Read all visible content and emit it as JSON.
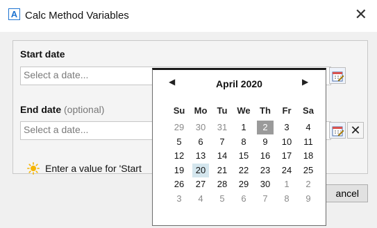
{
  "window": {
    "title": "Calc Method Variables",
    "app_icon_letter": "A",
    "close_glyph": "✕"
  },
  "form": {
    "start_label": "Start date",
    "start_placeholder": "Select a date...",
    "end_label": "End date",
    "end_optional": "(optional)",
    "end_placeholder": "Select a date...",
    "clear_glyph": "✕",
    "status_text": "Enter a value for 'Start",
    "cancel_label": "ancel"
  },
  "calendar": {
    "month_label": "April 2020",
    "prev_glyph": "◀",
    "next_glyph": "▶",
    "weekdays": [
      "Su",
      "Mo",
      "Tu",
      "We",
      "Th",
      "Fr",
      "Sa"
    ],
    "weeks": [
      [
        {
          "d": "29",
          "o": true
        },
        {
          "d": "30",
          "o": true
        },
        {
          "d": "31",
          "o": true
        },
        {
          "d": "1"
        },
        {
          "d": "2",
          "sel": true
        },
        {
          "d": "3"
        },
        {
          "d": "4"
        }
      ],
      [
        {
          "d": "5"
        },
        {
          "d": "6"
        },
        {
          "d": "7"
        },
        {
          "d": "8"
        },
        {
          "d": "9"
        },
        {
          "d": "10"
        },
        {
          "d": "11"
        }
      ],
      [
        {
          "d": "12"
        },
        {
          "d": "13"
        },
        {
          "d": "14"
        },
        {
          "d": "15"
        },
        {
          "d": "16"
        },
        {
          "d": "17"
        },
        {
          "d": "18"
        }
      ],
      [
        {
          "d": "19"
        },
        {
          "d": "20",
          "today": true
        },
        {
          "d": "21"
        },
        {
          "d": "22"
        },
        {
          "d": "23"
        },
        {
          "d": "24"
        },
        {
          "d": "25"
        }
      ],
      [
        {
          "d": "26"
        },
        {
          "d": "27"
        },
        {
          "d": "28"
        },
        {
          "d": "29"
        },
        {
          "d": "30"
        },
        {
          "d": "1",
          "o": true
        },
        {
          "d": "2",
          "o": true
        }
      ],
      [
        {
          "d": "3",
          "o": true
        },
        {
          "d": "4",
          "o": true
        },
        {
          "d": "5",
          "o": true
        },
        {
          "d": "6",
          "o": true
        },
        {
          "d": "7",
          "o": true
        },
        {
          "d": "8",
          "o": true
        },
        {
          "d": "9",
          "o": true
        }
      ]
    ]
  },
  "icons": {
    "app": "app-a-icon",
    "close": "close-icon",
    "calendar": "calendar-icon",
    "status": "sun-icon"
  },
  "colors": {
    "accent": "#1e73d1",
    "selected_day": "#9a9a9a",
    "today_day": "#d4e6ee",
    "status_icon": "#f5b400"
  }
}
